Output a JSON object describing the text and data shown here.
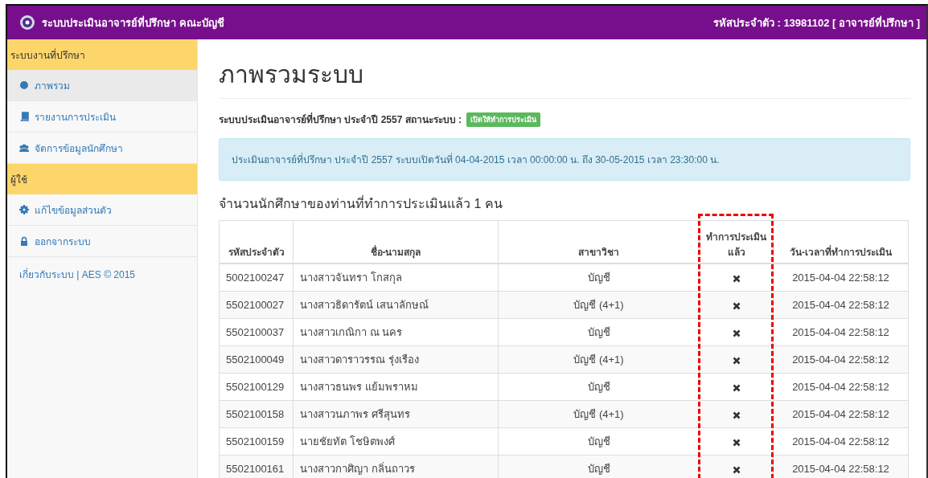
{
  "header": {
    "title": "ระบบประเมินอาจารย์ที่ปรึกษา คณะบัญชี",
    "user": "รหัสประจำตัว : 13981102 [ อาจารย์ที่ปรึกษา ]"
  },
  "sidebar": {
    "sections": [
      {
        "title": "ระบบงานที่ปรึกษา",
        "items": [
          {
            "label": "ภาพรวม",
            "kind": "dot",
            "selected": true
          },
          {
            "label": "รายงานการประเมิน",
            "kind": "book",
            "selected": false
          },
          {
            "label": "จัดการข้อมูลนักศึกษา",
            "kind": "users",
            "selected": false
          }
        ]
      },
      {
        "title": "ผู้ใช้",
        "items": [
          {
            "label": "แก้ไขข้อมูลส่วนตัว",
            "kind": "gear",
            "selected": false
          },
          {
            "label": "ออกจากระบบ",
            "kind": "lock",
            "selected": false
          }
        ]
      }
    ],
    "footer": "เกี่ยวกับระบบ | AES © 2015"
  },
  "page": {
    "title": "ภาพรวมระบบ",
    "status_text": "ระบบประเมินอาจารย์ที่ปรึกษา ประจำปี 2557 สถานะระบบ :",
    "status_badge": "เปิดให้ทำการประเมิน",
    "info": "ประเมินอาจารย์ที่ปรึกษา ประจำปี 2557 ระบบเปิดวันที่ 04-04-2015 เวลา 00:00:00 น. ถึง 30-05-2015 เวลา 23:30:00 น.",
    "count_heading": "จำนวนนักศึกษาของท่านที่ทำการประเมินแล้ว 1 คน"
  },
  "table": {
    "columns": [
      {
        "label": "รหัสประจำตัว",
        "highlighted": false
      },
      {
        "label": "ชื่อ-นามสกุล",
        "highlighted": false
      },
      {
        "label": "สาขาวิชา",
        "highlighted": false
      },
      {
        "label": "ทำการประเมินแล้ว",
        "highlighted": true
      },
      {
        "label": "วัน-เวลาที่ทำการประเมิน",
        "highlighted": false
      }
    ],
    "rows": [
      {
        "id": "5002100247",
        "name": "นางสาวจันทรา โกสกุล",
        "major": "บัญชี",
        "evaluated": false,
        "time": "2015-04-04 22:58:12"
      },
      {
        "id": "5502100027",
        "name": "นางสาวธิดารัตน์ เสนาลักษณ์",
        "major": "บัญชี (4+1)",
        "evaluated": false,
        "time": "2015-04-04 22:58:12"
      },
      {
        "id": "5502100037",
        "name": "นางสาวเกณิกา ณ นคร",
        "major": "บัญชี",
        "evaluated": false,
        "time": "2015-04-04 22:58:12"
      },
      {
        "id": "5502100049",
        "name": "นางสาวดาราวรรณ รุ่งเรือง",
        "major": "บัญชี (4+1)",
        "evaluated": false,
        "time": "2015-04-04 22:58:12"
      },
      {
        "id": "5502100129",
        "name": "นางสาวธนพร แย้มพราหม",
        "major": "บัญชี",
        "evaluated": false,
        "time": "2015-04-04 22:58:12"
      },
      {
        "id": "5502100158",
        "name": "นางสาวนภาพร ศรีสุนทร",
        "major": "บัญชี (4+1)",
        "evaluated": false,
        "time": "2015-04-04 22:58:12"
      },
      {
        "id": "5502100159",
        "name": "นายชัยทัต โชษิตพงศ์",
        "major": "บัญชี",
        "evaluated": false,
        "time": "2015-04-04 22:58:12"
      },
      {
        "id": "5502100161",
        "name": "นางสาวกาศิญา กลิ่นถาวร",
        "major": "บัญชี",
        "evaluated": false,
        "time": "2015-04-04 22:58:12"
      }
    ]
  }
}
